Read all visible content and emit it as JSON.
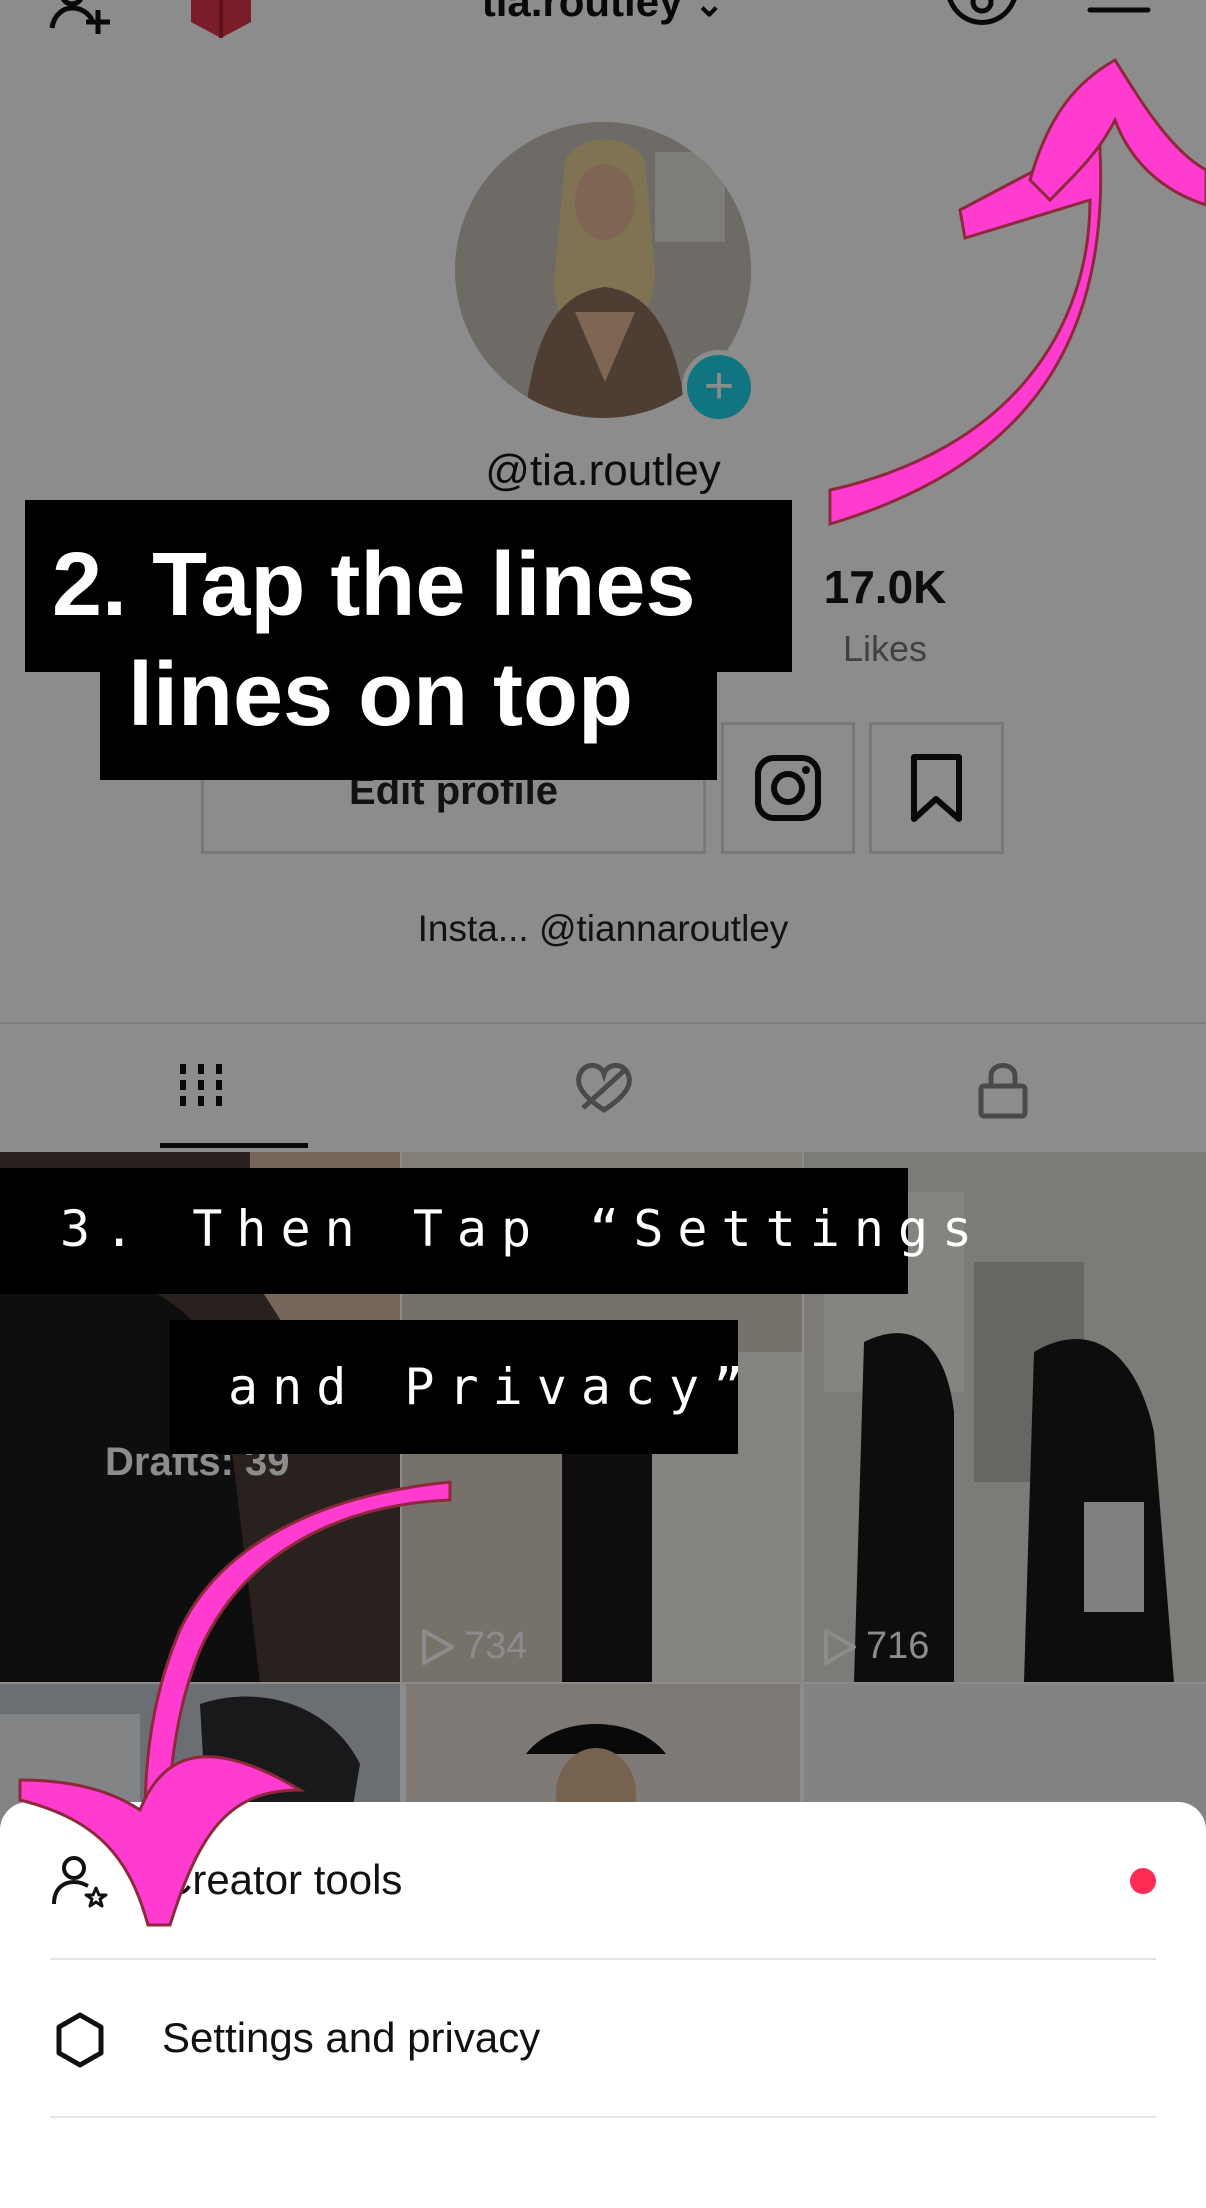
{
  "header": {
    "username": "tia.routley"
  },
  "profile": {
    "handle": "@tia.routley",
    "likes_value": "17.0K",
    "likes_label": "Likes",
    "edit_profile_label": "Edit profile",
    "bio": "Insta... @tiannaroutley"
  },
  "grid": {
    "drafts_label": "Drafts: 39",
    "cells": [
      {
        "views": ""
      },
      {
        "views": "734"
      },
      {
        "views": "716"
      }
    ]
  },
  "sheet": {
    "items": [
      {
        "label": "Creator tools",
        "icon": "creator-tools-icon",
        "has_dot": true
      },
      {
        "label": "Settings and privacy",
        "icon": "gear-icon",
        "has_dot": false
      }
    ]
  },
  "overlay": {
    "caption_line1": "2. Tap the lines",
    "caption_line2": "lines on top",
    "caption3_line1": "3. Then Tap “Settings",
    "caption3_line2": "and Privacy”"
  },
  "colors": {
    "accent_pink": "#ff3ccf",
    "dot_red": "#fe2c55",
    "avatar_plus": "#20d5ec"
  }
}
